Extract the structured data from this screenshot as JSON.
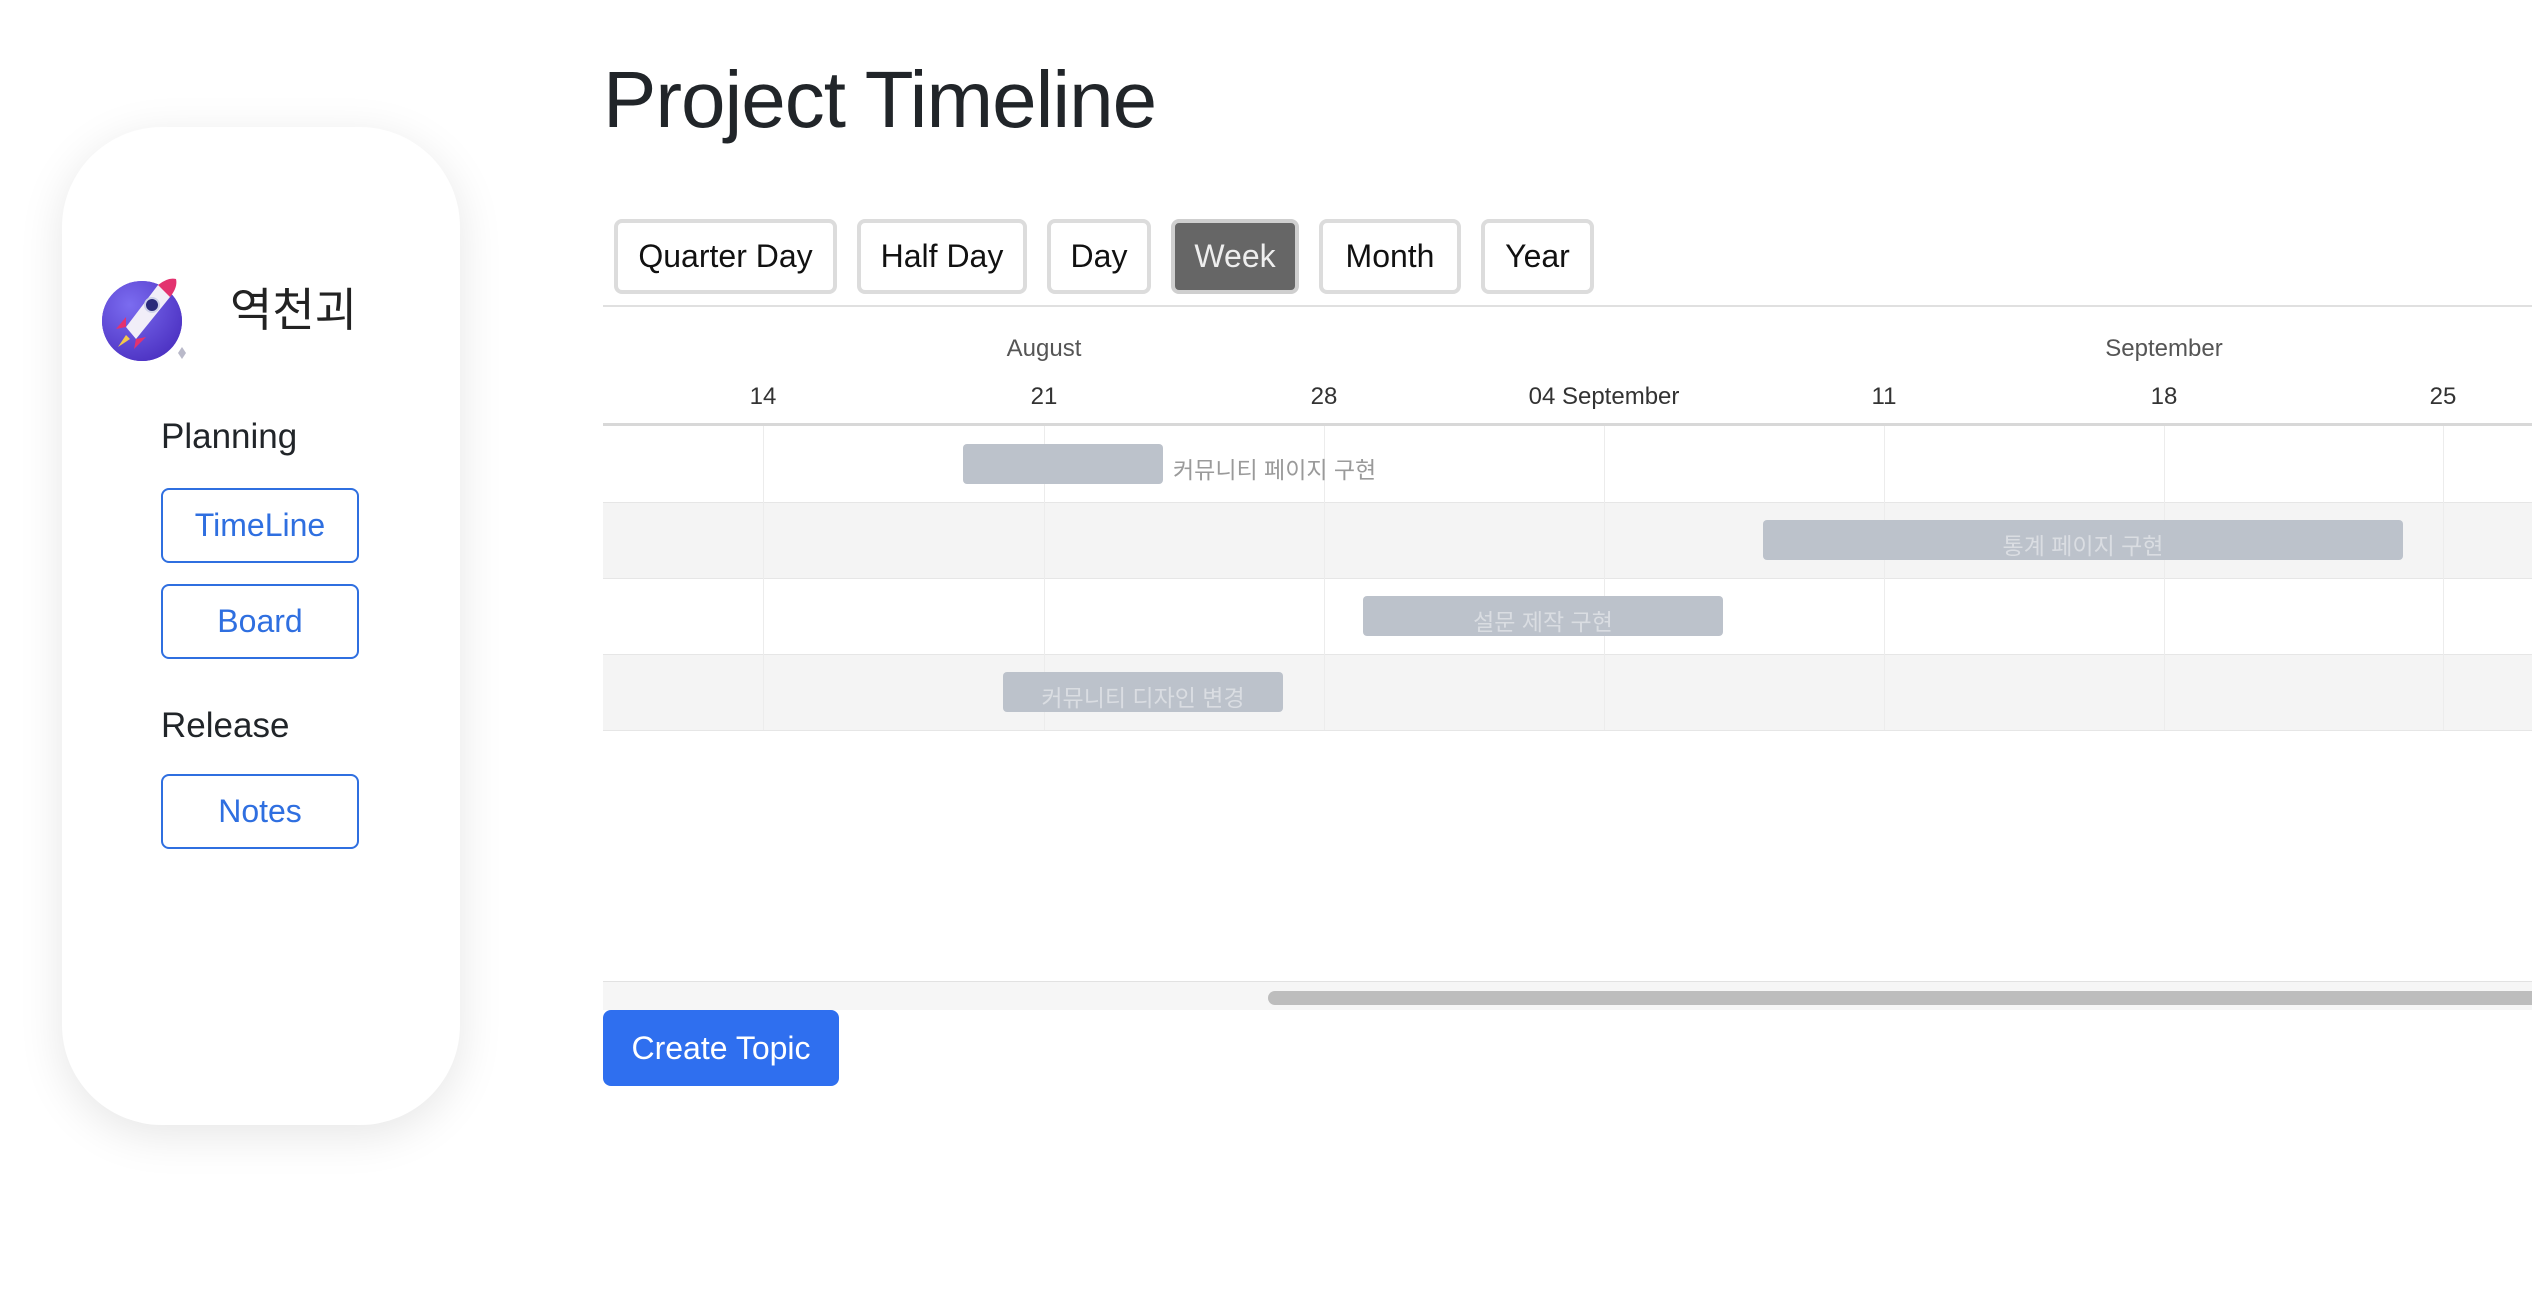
{
  "sidebar": {
    "brand_name": "역천괴",
    "logo_icon": "rocket-icon",
    "sections": [
      {
        "title": "Planning",
        "items": [
          "TimeLine",
          "Board"
        ]
      },
      {
        "title": "Release",
        "items": [
          "Notes"
        ]
      }
    ]
  },
  "main": {
    "title": "Project Timeline",
    "view_modes": [
      "Quarter Day",
      "Half Day",
      "Day",
      "Week",
      "Month",
      "Year"
    ],
    "active_view_mode": "Week",
    "create_button_label": "Create Topic"
  },
  "gantt": {
    "months": [
      "August",
      "September"
    ],
    "weeks": [
      "14",
      "21",
      "28",
      "04 September",
      "11",
      "18",
      "25"
    ],
    "tasks": [
      {
        "name": "커뮤니티 페이지 구현",
        "start": "2023-08-19",
        "end": "2023-08-24",
        "label_position": "outside"
      },
      {
        "name": "통계 페이지 구현",
        "start": "2023-09-08",
        "end": "2023-09-24",
        "label_position": "inside"
      },
      {
        "name": "설문 제작 구현",
        "start": "2023-08-29",
        "end": "2023-09-07",
        "label_position": "inside"
      },
      {
        "name": "커뮤니티 디자인 변경",
        "start": "2023-08-20",
        "end": "2023-08-27",
        "label_position": "inside"
      }
    ]
  },
  "colors": {
    "accent": "#2f6fef",
    "active_view": "#666666",
    "task_bar": "#bcc2cb"
  }
}
